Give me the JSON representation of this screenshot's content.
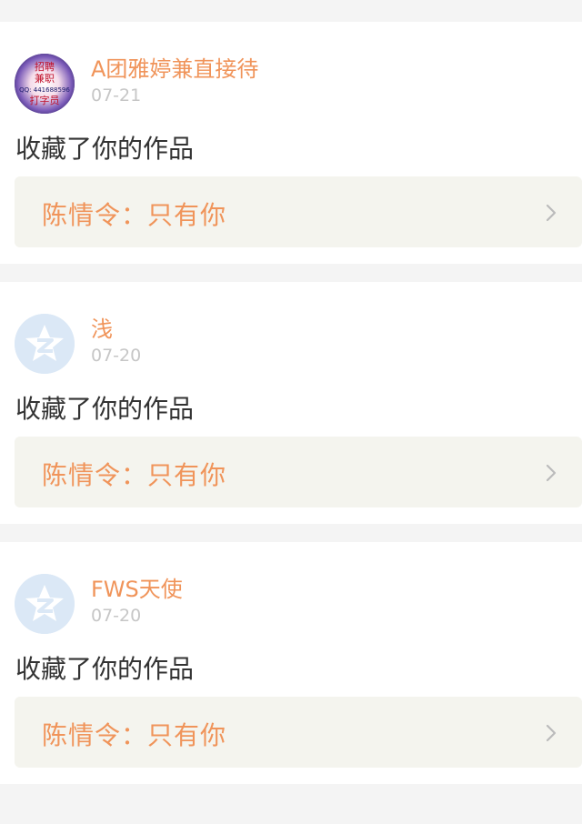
{
  "notifications": [
    {
      "user": "A团雅婷兼直接待",
      "date": "07-21",
      "action": "收藏了你的作品",
      "work": "陈情令：只有你",
      "avatar": {
        "type": "custom",
        "lines": [
          "招聘",
          "兼职",
          "打字员"
        ],
        "qq": "QQ: 441688596"
      }
    },
    {
      "user": "浅",
      "date": "07-20",
      "action": "收藏了你的作品",
      "work": "陈情令：只有你",
      "avatar": {
        "type": "default"
      }
    },
    {
      "user": "FWS天使",
      "date": "07-20",
      "action": "收藏了你的作品",
      "work": "陈情令：只有你",
      "avatar": {
        "type": "default"
      }
    }
  ],
  "icons": {
    "chevron": "chevron-right-icon",
    "default_avatar": "zhihu-default-avatar-icon"
  },
  "colors": {
    "accent": "#f0945a",
    "date": "#c6c6c6",
    "text": "#333333",
    "card_bg": "#ffffff",
    "work_bg": "#f4f4ee",
    "page_bg": "#f4f4f4",
    "default_avatar": "#dbe8f6"
  }
}
